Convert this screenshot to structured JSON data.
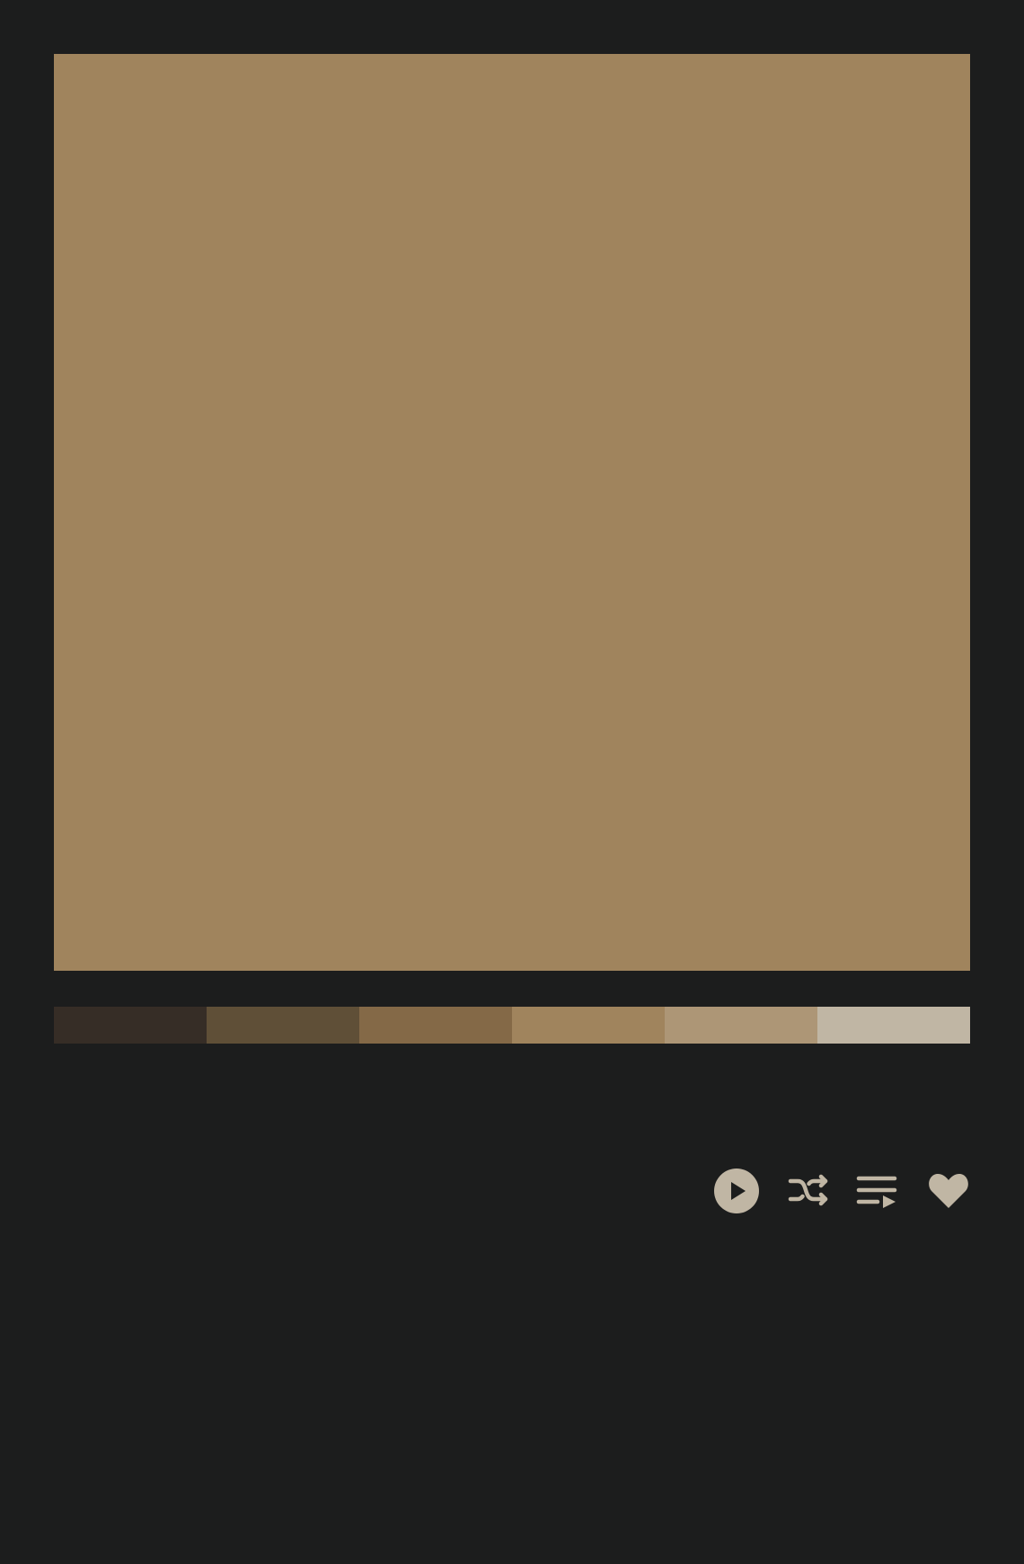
{
  "album": {
    "cover_color": "#a0845d"
  },
  "palette": {
    "swatches": [
      "#362d26",
      "#5f4f37",
      "#846947",
      "#a0845d",
      "#ad9676",
      "#c0b6a4"
    ]
  },
  "controls": {
    "icon_color": "#c0b6a4",
    "background_color": "#1c1d1d",
    "icons": [
      "play-circle-icon",
      "shuffle-icon",
      "queue-icon",
      "heart-icon"
    ]
  }
}
